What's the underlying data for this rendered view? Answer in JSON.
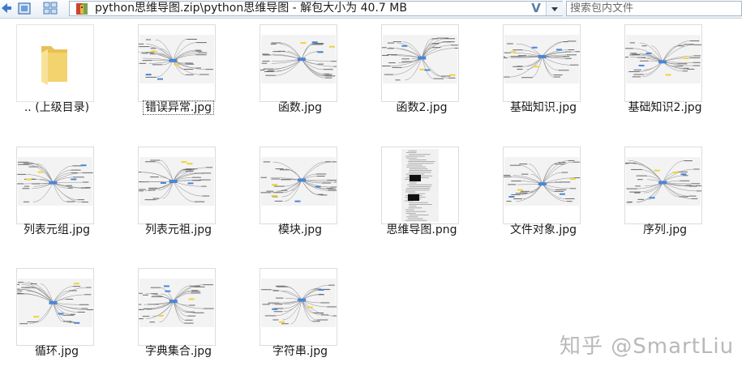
{
  "address_bar": {
    "path": "python思维导图.zip\\python思维导图 - 解包大小为 40.7 MB",
    "dropdown_glyph": "V"
  },
  "search": {
    "placeholder": "搜索包内文件"
  },
  "files": [
    {
      "name": ".. (上级目录)",
      "type": "folder"
    },
    {
      "name": "错误异常.jpg",
      "type": "image",
      "selected": true
    },
    {
      "name": "函数.jpg",
      "type": "image"
    },
    {
      "name": "函数2.jpg",
      "type": "image"
    },
    {
      "name": "基础知识.jpg",
      "type": "image"
    },
    {
      "name": "基础知识2.jpg",
      "type": "image"
    },
    {
      "name": "列表元组.jpg",
      "type": "image"
    },
    {
      "name": "列表元祖.jpg",
      "type": "image"
    },
    {
      "name": "模块.jpg",
      "type": "image"
    },
    {
      "name": "思维导图.png",
      "type": "image-dark"
    },
    {
      "name": "文件对象.jpg",
      "type": "image"
    },
    {
      "name": "序列.jpg",
      "type": "image"
    },
    {
      "name": "循环.jpg",
      "type": "image"
    },
    {
      "name": "字典集合.jpg",
      "type": "image"
    },
    {
      "name": "字符串.jpg",
      "type": "image"
    }
  ],
  "watermark": "知乎 @SmartLiu",
  "colors": {
    "folder": "#f3d36e",
    "mindmap_accent_blue": "#4a86d8",
    "mindmap_accent_yellow": "#f2d23a",
    "watermark": "#b9b9b9"
  }
}
